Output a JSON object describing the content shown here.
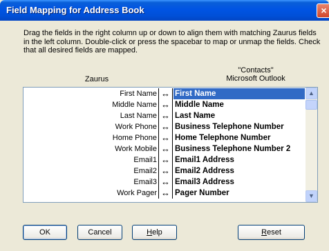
{
  "window": {
    "title": "Field Mapping for Address Book",
    "close_icon": "×"
  },
  "instructions": "Drag the fields in the right column up or down to align them with matching Zaurus fields in the left column.  Double-click or press the spacebar to map or unmap the fields.  Check that all desired fields are mapped.",
  "columns": {
    "left_header": "Zaurus",
    "right_header_line1": "\"Contacts\"",
    "right_header_line2": "Microsoft Outlook"
  },
  "mapping": {
    "arrow_glyph": "↔",
    "rows": [
      {
        "left": "First Name",
        "right": "First Name"
      },
      {
        "left": "Middle Name",
        "right": "Middle Name"
      },
      {
        "left": "Last Name",
        "right": "Last Name"
      },
      {
        "left": "Work Phone",
        "right": "Business Telephone Number"
      },
      {
        "left": "Home Phone",
        "right": "Home Telephone Number"
      },
      {
        "left": "Work Mobile",
        "right": "Business Telephone Number 2"
      },
      {
        "left": "Email1",
        "right": "Email1 Address"
      },
      {
        "left": "Email2",
        "right": "Email2 Address"
      },
      {
        "left": "Email3",
        "right": "Email3 Address"
      },
      {
        "left": "Work Pager",
        "right": "Pager Number"
      }
    ],
    "selected_index": 0,
    "scroll_up_icon": "▲",
    "scroll_down_icon": "▼"
  },
  "buttons": {
    "ok": "OK",
    "cancel": "Cancel",
    "help_mnemonic": "H",
    "help_rest": "elp",
    "reset_mnemonic": "R",
    "reset_rest": "eset"
  }
}
